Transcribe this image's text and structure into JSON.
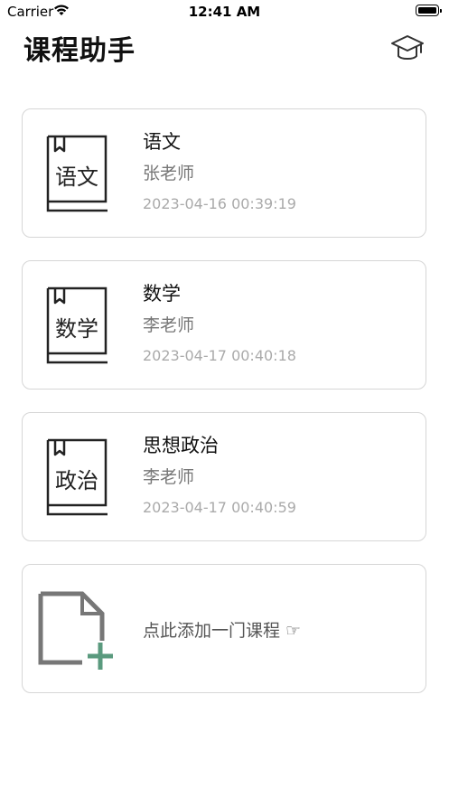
{
  "status_bar": {
    "carrier": "Carrier",
    "time": "12:41 AM"
  },
  "header": {
    "title": "课程助手",
    "icon": "graduation-cap-icon"
  },
  "courses": [
    {
      "book_label": "语文",
      "name": "语文",
      "teacher": "张老师",
      "created": "2023-04-16 00:39:19"
    },
    {
      "book_label": "数学",
      "name": "数学",
      "teacher": "李老师",
      "created": "2023-04-17 00:40:18"
    },
    {
      "book_label": "政治",
      "name": "思想政治",
      "teacher": "李老师",
      "created": "2023-04-17 00:40:59"
    }
  ],
  "add_course": {
    "label": "点此添加一门课程 ☞",
    "icon": "add-document-icon"
  },
  "colors": {
    "card_border": "#d6d6d6",
    "add_accent": "#5a9a7e",
    "secondary_text": "#777777",
    "timestamp_text": "#aaaaaa"
  }
}
